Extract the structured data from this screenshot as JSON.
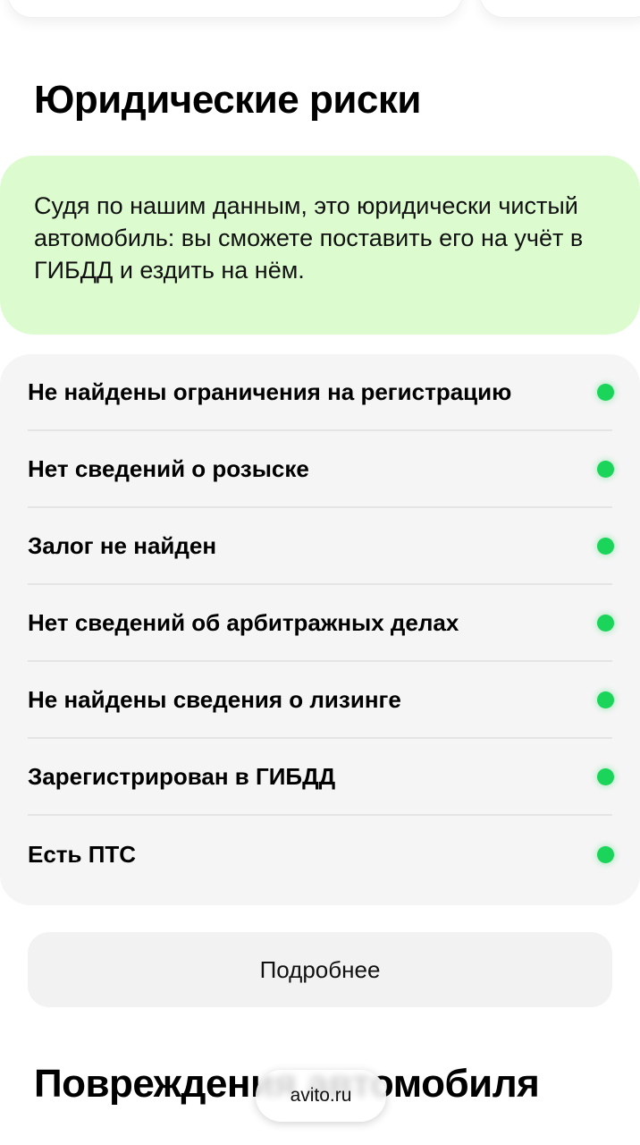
{
  "legal_risks": {
    "title": "Юридические риски",
    "verdict_text": "Судя по нашим данным, это юридически чистый автомобиль: вы сможете поставить его на учёт в ГИБДД и ездить на нём.",
    "status_color": "#1bd45a",
    "checks": [
      {
        "label": "Не найдены ограничения на регистрацию",
        "status": "ok"
      },
      {
        "label": "Нет сведений о розыске",
        "status": "ok"
      },
      {
        "label": "Залог не найден",
        "status": "ok"
      },
      {
        "label": "Нет сведений об арбитражных делах",
        "status": "ok"
      },
      {
        "label": "Не найдены сведения о лизинге",
        "status": "ok"
      },
      {
        "label": "Зарегистрирован в ГИБДД",
        "status": "ok"
      },
      {
        "label": "Есть ПТС",
        "status": "ok"
      }
    ],
    "more_button_label": "Подробнее"
  },
  "damage_section": {
    "title": "Повреждения автомобиля"
  },
  "browser": {
    "url": "avito.ru"
  }
}
